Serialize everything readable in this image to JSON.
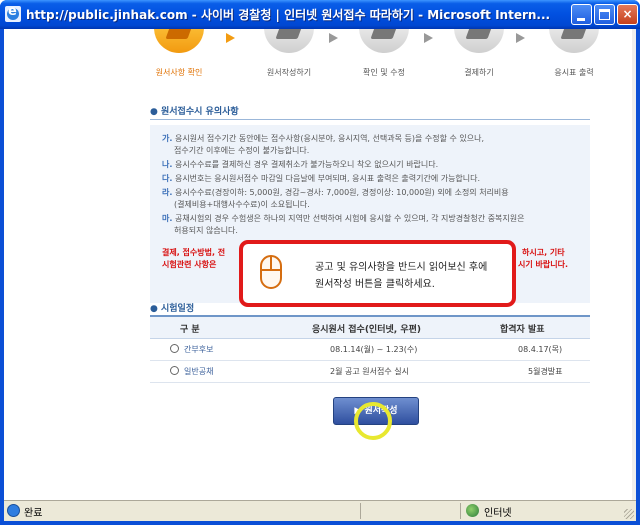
{
  "window": {
    "title": "http://public.jinhak.com - 사이버 경찰청 | 인터넷 원서접수 따라하기 - Microsoft Intern...",
    "min_glyph": "minimize",
    "max_glyph": "maximize",
    "close_glyph": "×"
  },
  "steps": [
    {
      "label": "원서사항 확인",
      "active": true
    },
    {
      "label": "원서작성하기",
      "active": false
    },
    {
      "label": "확인 및 수정",
      "active": false
    },
    {
      "label": "결제하기",
      "active": false
    },
    {
      "label": "응시표 출력",
      "active": false
    }
  ],
  "notice": {
    "title": "원서접수시 유의사항",
    "items": [
      {
        "mark": "가.",
        "text": "응시원서 접수기간 동안에는 접수사항(응시분야, 응시지역, 선택과목 등)을 수정할 수 있으나,"
      },
      {
        "mark": "",
        "text": "접수기간 이후에는 수정이 불가능합니다."
      },
      {
        "mark": "나.",
        "text": "응시수수료를 결제하신 경우 결제취소가 불가능하오니 착오 없으시기 바랍니다."
      },
      {
        "mark": "다.",
        "text": "응시번호는 응시원서접수 마감일 다음날에 부여되며, 응시표 출력은 출력기간에 가능합니다."
      },
      {
        "mark": "라.",
        "text": "응시수수료(경장이하: 5,000원, 경감~경사: 7,000원, 경정이상: 10,000원) 외에 소정의 처리비용"
      },
      {
        "mark": "",
        "text": "(결제비용+대행사수수료)이 소요됩니다."
      },
      {
        "mark": "마.",
        "text": "공채시험의 경우 수험생은 하나의 지역만 선택하여 시험에 응시할 수 있으며, 각 지방경찰청간 중복지원은"
      },
      {
        "mark": "",
        "text": "허용되지 않습니다."
      }
    ],
    "warn_left_1": "결제, 접수방법, 전",
    "warn_left_2": "시험관련 사항은 ",
    "warn_right_1": "하시고, 기타",
    "warn_right_2": "시기 바랍니다."
  },
  "callout": {
    "line1": "공고 및 유의사항을 반드시 읽어보신 후에",
    "line2": "원서작성 버튼을 클릭하세요."
  },
  "schedule": {
    "title": "시험일정",
    "headers": [
      "구 분",
      "응시원서 접수(인터넷, 우편)",
      "합격자 발표"
    ],
    "rows": [
      {
        "name": "간부후보",
        "period": "08.1.14(월) ~ 1.23(수)",
        "result": "08.4.17(목)"
      },
      {
        "name": "일반공채",
        "period": "2월 공고 원서접수 실시",
        "result": "5월경발표"
      }
    ]
  },
  "submit": {
    "label": "▶ 원서작성"
  },
  "status": {
    "text": "완료",
    "zone": "인터넷"
  }
}
